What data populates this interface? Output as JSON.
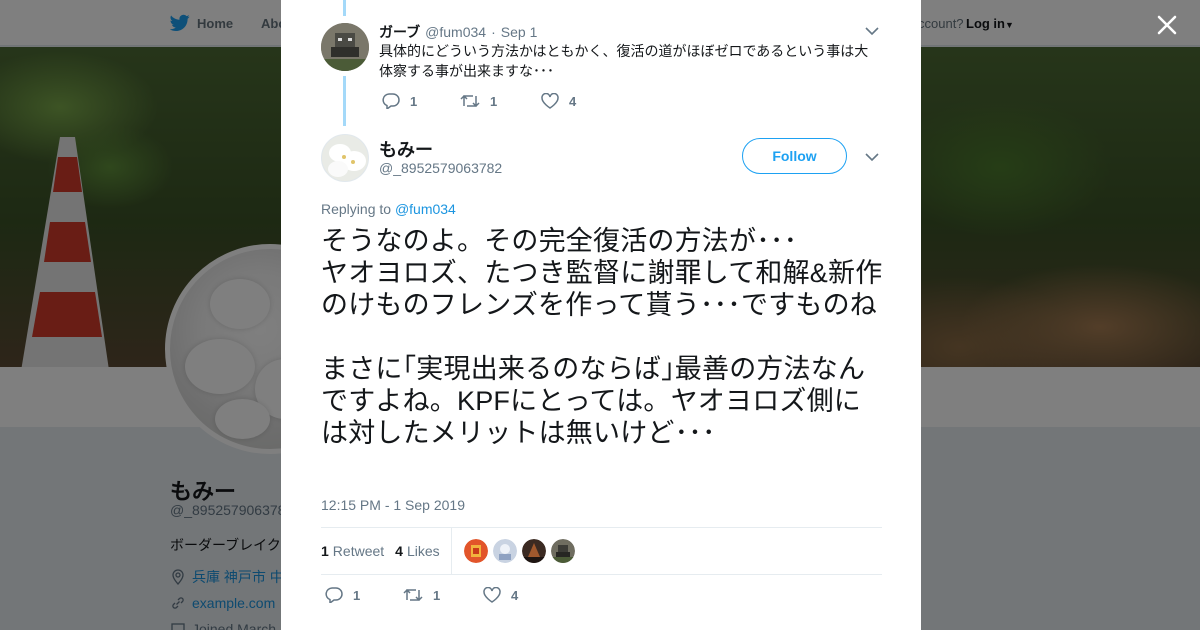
{
  "background_page": {
    "nav": {
      "home": "Home",
      "about": "Abo",
      "account_prompt": "ccount?",
      "login": "Log in"
    },
    "profile": {
      "name": "もみー",
      "handle": "@_895257906378",
      "bio": "ボーダーブレイク",
      "location": "兵庫 神戸市 中",
      "link": "example.com",
      "joined": "Joined March"
    }
  },
  "modal": {
    "close_icon": "close-icon",
    "parent_tweet": {
      "name": "ガーブ",
      "handle": "@fum034",
      "dot": "·",
      "date": "Sep 1",
      "text": "具体的にどういう方法かはともかく、復活の道がほぼゼロであるという事は大体察する事が出来ますな･･･",
      "replies": "1",
      "retweets": "1",
      "likes": "4"
    },
    "main_tweet": {
      "name": "もみー",
      "handle": "@_8952579063782",
      "follow_label": "Follow",
      "replying_to_label": "Replying to",
      "replying_to_handle": "@fum034",
      "text": "そうなのよ。その完全復活の方法が･･･\nヤオヨロズ、たつき監督に謝罪して和解&新作のけものフレンズを作って貰う･･･ですものね\n\nまさに｢実現出来るのならば｣最善の方法なんですよね。KPFにとっては。ヤオヨロズ側には対したメリットは無いけど･･･",
      "timestamp": "12:15 PM - 1 Sep 2019",
      "retweet_count": "1",
      "retweet_label": "Retweet",
      "like_count": "4",
      "like_label": "Likes",
      "replies": "1",
      "retweets": "1",
      "likes": "4"
    }
  },
  "colors": {
    "accent": "#1da1f2",
    "thread_line": "#a4d9f9",
    "secondary_text": "#657786"
  }
}
